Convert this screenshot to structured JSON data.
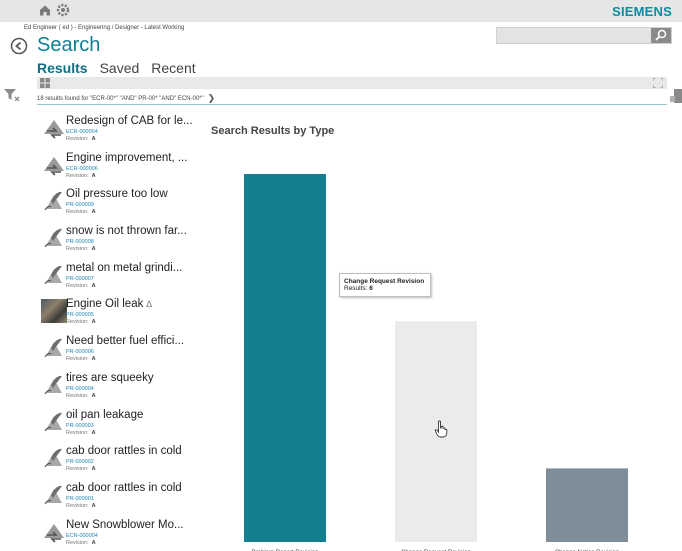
{
  "header": {
    "brand": "SIEMENS",
    "user_line": "Ed Engineer ( ed ) - Engineering / Designer - Latest Working",
    "title": "Search",
    "search_placeholder": ""
  },
  "tabs": [
    {
      "label": "Results",
      "active": true
    },
    {
      "label": "Saved",
      "active": false
    },
    {
      "label": "Recent",
      "active": false
    }
  ],
  "results": {
    "summary": "18 results found for \"ECR-00*\" \"AND\" PR-00* \"AND\" ECN-00*\"",
    "revision_label": "Revision:",
    "items": [
      {
        "title": "Redesign of CAB for le...",
        "id": "ECR-000004",
        "rev": "A",
        "icon": "change-request-icon"
      },
      {
        "title": "Engine improvement, ...",
        "id": "ECR-000006",
        "rev": "A",
        "icon": "change-request-icon"
      },
      {
        "title": "Oil pressure too low",
        "id": "PR-000009",
        "rev": "A",
        "icon": "problem-report-icon"
      },
      {
        "title": "snow is not thrown far...",
        "id": "PR-000008",
        "rev": "A",
        "icon": "problem-report-icon"
      },
      {
        "title": "metal on metal grindi...",
        "id": "PR-000007",
        "rev": "A",
        "icon": "problem-report-icon"
      },
      {
        "title": "Engine Oil leak",
        "id": "PR-000005",
        "rev": "A",
        "icon": "engine-thumbnail"
      },
      {
        "title": "Need better fuel effici...",
        "id": "PR-000006",
        "rev": "A",
        "icon": "problem-report-icon"
      },
      {
        "title": "tires are squeeky",
        "id": "PR-000004",
        "rev": "A",
        "icon": "problem-report-icon"
      },
      {
        "title": "oil pan leakage",
        "id": "PR-000003",
        "rev": "A",
        "icon": "problem-report-icon"
      },
      {
        "title": "cab door rattles in cold",
        "id": "PR-000002",
        "rev": "A",
        "icon": "problem-report-icon"
      },
      {
        "title": "cab door rattles in cold",
        "id": "PR-000001",
        "rev": "A",
        "icon": "problem-report-icon"
      },
      {
        "title": "New Snowblower Mo...",
        "id": "ECN-000004",
        "rev": "A",
        "icon": "change-notice-icon"
      }
    ]
  },
  "chart_data": {
    "type": "bar",
    "title": "Search Results by Type",
    "categories": [
      "Problem Report Revision",
      "Change Request Revision",
      "Change Notice Revision"
    ],
    "values": [
      10,
      6,
      2
    ],
    "colors": [
      "#137f8f",
      "#ebebeb",
      "#7f8d99"
    ],
    "ylim": [
      0,
      10
    ],
    "grid": false,
    "tooltip": {
      "title": "Change Request Revision",
      "label": "Results:",
      "value": "6"
    }
  },
  "colors": {
    "accent": "#0e7f94",
    "brand": "#0f8aa0"
  }
}
